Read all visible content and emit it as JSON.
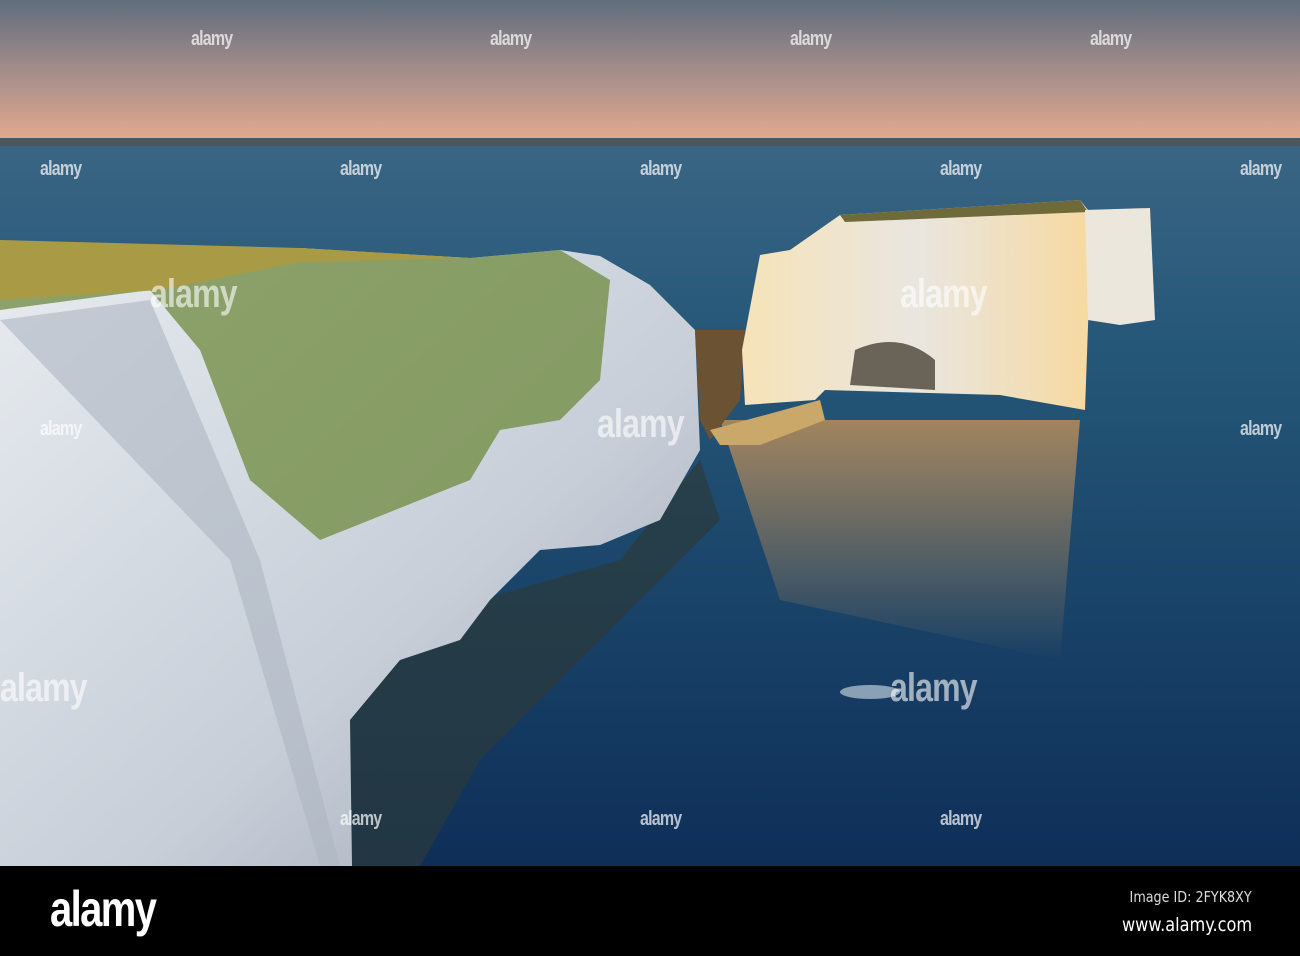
{
  "photo": {
    "subject": "chalk-cliffs-and-sea-stacks-at-sunrise",
    "colors": {
      "sky_top": "#5b6a7a",
      "sky_horizon": "#e2a98c",
      "sea": "#1f4f73",
      "sea_deep": "#0f2f55",
      "chalk": "#dfe4ea",
      "chalk_lit": "#f3dcae",
      "grass": "#5e7a32"
    }
  },
  "watermark": {
    "text": "alamy"
  },
  "footer": {
    "logo": "alamy",
    "image_id": "Image ID: 2FYK8XY",
    "url": "www.alamy.com"
  }
}
